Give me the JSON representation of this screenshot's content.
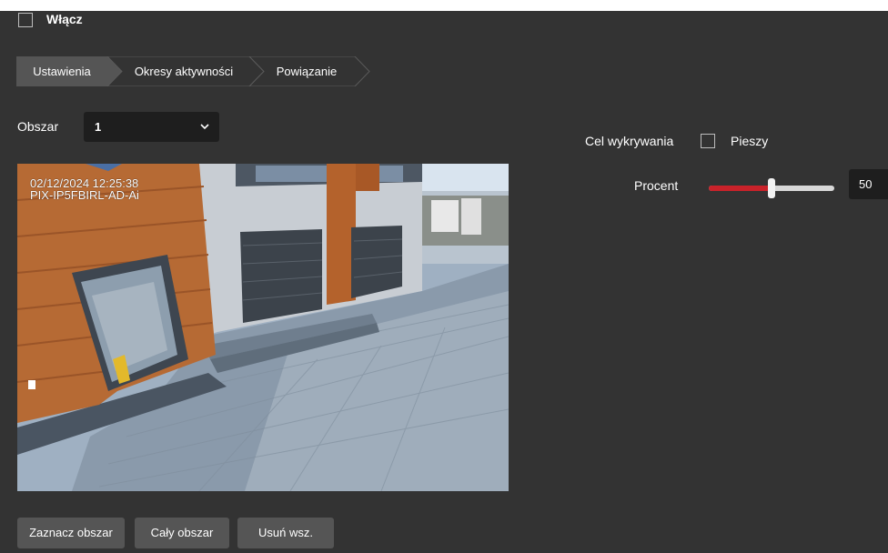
{
  "enable": {
    "label": "Włącz",
    "checked": false
  },
  "tabs": [
    {
      "label": "Ustawienia",
      "active": true
    },
    {
      "label": "Okresy aktywności",
      "active": false
    },
    {
      "label": "Powiązanie",
      "active": false
    }
  ],
  "area": {
    "label": "Obszar",
    "value": "1"
  },
  "detection": {
    "target_label": "Cel wykrywania",
    "pedestrian_label": "Pieszy",
    "pedestrian_checked": false,
    "percent_label": "Procent",
    "percent_value": "50",
    "percent_fraction": 0.5
  },
  "video": {
    "osd_datetime": "02/12/2024  12:25:38",
    "osd_camera": "PIX-IP5FBIRL-AD-Ai"
  },
  "buttons": {
    "mark_area": "Zaznacz obszar",
    "full_area": "Cały obszar",
    "delete_all": "Usuń wsz."
  },
  "colors": {
    "panel_bg": "#333333",
    "tab_active": "#555555",
    "tab_inactive": "#333333",
    "slider_fill": "#c9222a",
    "button_bg": "#555555"
  }
}
